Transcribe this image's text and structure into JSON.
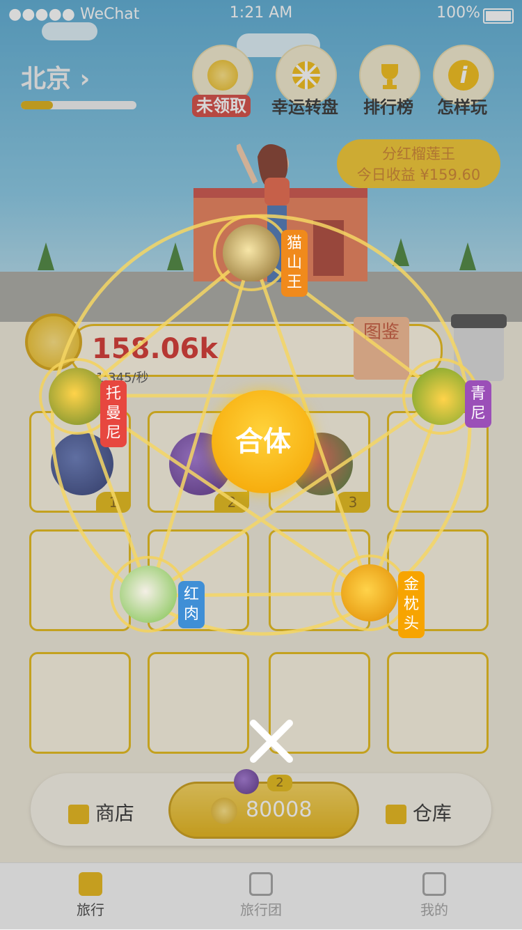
{
  "status_bar": {
    "carrier": "●●●●● WeChat",
    "time": "1:21 AM",
    "battery": "100%"
  },
  "header": {
    "city": "北京 ›",
    "progress": 0.28,
    "buttons": [
      {
        "label": "未领取",
        "icon": "coin-star-icon"
      },
      {
        "label": "幸运转盘",
        "icon": "wheel-icon"
      },
      {
        "label": "排行榜",
        "icon": "trophy-icon"
      },
      {
        "label": "怎样玩",
        "icon": "info-icon"
      }
    ]
  },
  "dividend": {
    "title": "分红榴莲王",
    "income": "今日收益 ¥159.60"
  },
  "earnings": {
    "total": "158.06k",
    "rate": "1.345/秒",
    "atlas": "图鉴"
  },
  "grid": {
    "levels": [
      "1",
      "2",
      "3"
    ]
  },
  "merge": {
    "button": "合体",
    "nodes": [
      {
        "label": "猫山王",
        "color": "#f08a1c"
      },
      {
        "label": "托曼尼",
        "color": "#e7473f"
      },
      {
        "label": "青尼",
        "color": "#9b4fb8"
      },
      {
        "label": "红肉",
        "color": "#3f8fd6"
      },
      {
        "label": "金枕头",
        "color": "#f7a400"
      }
    ]
  },
  "bottom": {
    "shop": "商店",
    "price": "80008",
    "badge": "2",
    "warehouse": "仓库"
  },
  "tabs": [
    {
      "label": "旅行",
      "active": true
    },
    {
      "label": "旅行团",
      "active": false
    },
    {
      "label": "我的",
      "active": false
    }
  ],
  "colors": {
    "accent": "#e3b400",
    "red": "#d2231d"
  }
}
